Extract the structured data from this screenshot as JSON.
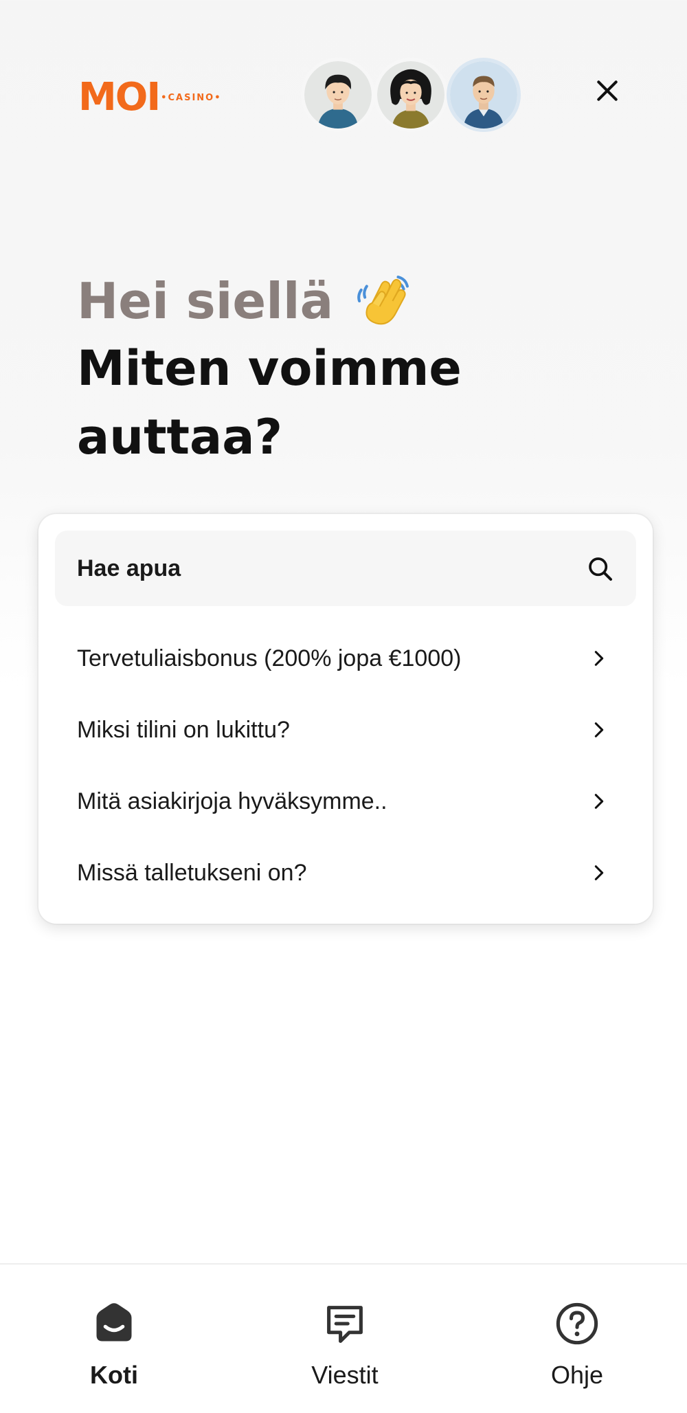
{
  "brand": {
    "logo_main": "MOI",
    "logo_sub": "•CASINO•",
    "accent": "#f26a1b"
  },
  "header": {
    "avatars": [
      "support-agent-1",
      "support-agent-2",
      "support-agent-3"
    ],
    "close_icon": "close-icon"
  },
  "greeting": {
    "line1": "Hei siellä",
    "line2": "Miten voimme auttaa?",
    "emoji_icon": "waving-hand-icon"
  },
  "search": {
    "label": "Hae apua",
    "icon": "search-icon"
  },
  "help_items": [
    {
      "label": "Tervetuliaisbonus (200% jopa €1000)"
    },
    {
      "label": "Miksi tilini on lukittu?"
    },
    {
      "label": "Mitä asiakirjoja hyväksymme.."
    },
    {
      "label": "Missä talletukseni on?"
    }
  ],
  "nav": {
    "tabs": [
      {
        "label": "Koti",
        "icon": "home-icon",
        "active": true
      },
      {
        "label": "Viestit",
        "icon": "messages-icon",
        "active": false
      },
      {
        "label": "Ohje",
        "icon": "help-icon",
        "active": false
      }
    ]
  }
}
